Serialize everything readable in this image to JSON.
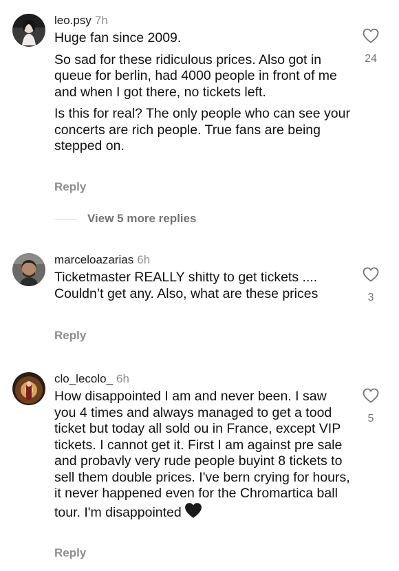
{
  "comments": [
    {
      "username": "leo.psy",
      "time": "7h",
      "paragraphs": [
        "Huge fan since 2009.",
        "So sad for these ridiculous prices. Also got in queue for berlin, had 4000 people in front of me and when I got there, no tickets left.",
        "Is this for real? The only people who can see your concerts are rich people. True fans are being stepped on."
      ],
      "reply_label": "Reply",
      "like_count": "24",
      "view_replies_label": "View 5 more replies"
    },
    {
      "username": "marceloazarias",
      "time": "6h",
      "paragraphs": [
        "Ticketmaster REALLY shitty to get tickets .... Couldn’t get any. Also, what are these prices"
      ],
      "reply_label": "Reply",
      "like_count": "3"
    },
    {
      "username": "clo_lecolo_",
      "time": "6h",
      "paragraphs": [
        "How disappointed I am and never been. I saw you 4 times and always managed to get a tood ticket but today all sold ou in France, except VIP tickets. I cannot get it. First I am against pre sale and probavly very rude people buyint 8 tickets to sell them double prices. I've bern crying for hours, it never happened even for the Chromartica ball tour. I'm disappointed"
      ],
      "emoji": "black-heart",
      "reply_label": "Reply",
      "like_count": "5"
    }
  ],
  "colors": {
    "text": "#111111",
    "muted": "#8e8e8e",
    "count": "#737373"
  }
}
